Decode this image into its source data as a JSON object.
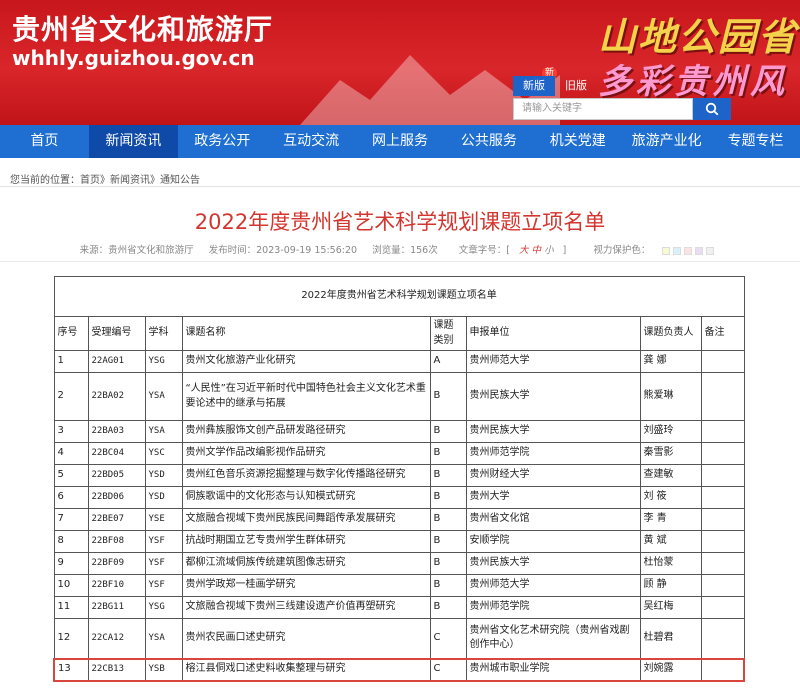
{
  "header": {
    "site_name": "贵州省文化和旅游厅",
    "site_url": "whhly.guizhou.gov.cn",
    "slogan_line1": "山地公园省",
    "slogan_line2": "多彩贵州风",
    "version_new": "新版",
    "version_old": "旧版",
    "new_badge": "新",
    "search_placeholder": "请输入关键字",
    "colors": {
      "banner_red": "#c8171c",
      "nav_blue": "#1e6fd1"
    }
  },
  "nav": {
    "items": [
      "首页",
      "新闻资讯",
      "政务公开",
      "互动交流",
      "网上服务",
      "公共服务",
      "机关党建",
      "旅游产业化",
      "专题专栏"
    ],
    "active_index": 1
  },
  "breadcrumb": {
    "prefix": "您当前的位置：",
    "home": "首页",
    "sep1": "》",
    "news": "新闻资讯",
    "sep2": "》",
    "notice": "通知公告"
  },
  "article": {
    "title": "2022年度贵州省艺术科学规划课题立项名单",
    "source": "来源：贵州省文化和旅游厅",
    "publish_time": "发布时间：2023-09-19 15:56:20",
    "views": "浏览量：156次",
    "font_size_label": "文章字号：[",
    "font_large": "大",
    "font_mid": "中",
    "font_small": "小",
    "font_close": "]",
    "eye_care": "视力保护色："
  },
  "table": {
    "caption": "2022年度贵州省艺术科学规划课题立项名单",
    "headers": [
      "序号",
      "受理编号",
      "学科",
      "课题名称",
      "课题类别",
      "申报单位",
      "课题负责人",
      "备注"
    ],
    "rows": [
      [
        "1",
        "22AG01",
        "YSG",
        "贵州文化旅游产业化研究",
        "A",
        "贵州师范大学",
        "龚  娜",
        ""
      ],
      [
        "2",
        "22BA02",
        "YSA",
        "“人民性”在习近平新时代中国特色社会主义文化艺术重要论述中的继承与拓展",
        "B",
        "贵州民族大学",
        "熊爱琳",
        ""
      ],
      [
        "3",
        "22BA03",
        "YSA",
        "贵州彝族服饰文创产品研发路径研究",
        "B",
        "贵州民族大学",
        "刘盛玲",
        ""
      ],
      [
        "4",
        "22BC04",
        "YSC",
        "贵州文学作品改编影视作品研究",
        "B",
        "贵州师范学院",
        "秦雪影",
        ""
      ],
      [
        "5",
        "22BD05",
        "YSD",
        "贵州红色音乐资源挖掘整理与数字化传播路径研究",
        "B",
        "贵州财经大学",
        "查建敏",
        ""
      ],
      [
        "6",
        "22BD06",
        "YSD",
        "侗族歌谣中的文化形态与认知模式研究",
        "B",
        "贵州大学",
        "刘  筱",
        ""
      ],
      [
        "7",
        "22BE07",
        "YSE",
        "文旅融合视域下贵州民族民间舞蹈传承发展研究",
        "B",
        "贵州省文化馆",
        "李  青",
        ""
      ],
      [
        "8",
        "22BF08",
        "YSF",
        " 抗战时期国立艺专贵州学生群体研究",
        "B",
        "安顺学院",
        "黄  斌",
        ""
      ],
      [
        "9",
        "22BF09",
        "YSF",
        "都柳江流域侗族传统建筑图像志研究",
        "B",
        "贵州民族大学",
        "杜怡蒙",
        ""
      ],
      [
        "10",
        "22BF10",
        "YSF",
        "贵州学政郑一桂画学研究",
        "B",
        "贵州师范大学",
        "顾  静",
        ""
      ],
      [
        "11",
        "22BG11",
        "YSG",
        "文旅融合视域下贵州三线建设遗产价值再塑研究",
        "B",
        "贵州师范学院",
        "吴红梅",
        ""
      ],
      [
        "12",
        "22CA12",
        "YSA",
        "贵州农民画口述史研究",
        "C",
        "贵州省文化艺术研究院（贵州省戏剧创作中心）",
        "杜碧君",
        ""
      ],
      [
        "13",
        "22CB13",
        "YSB",
        "榕江县侗戏口述史料收集整理与研究",
        "C",
        "贵州城市职业学院",
        "刘婉露",
        ""
      ]
    ],
    "highlight_row_index": 12
  }
}
